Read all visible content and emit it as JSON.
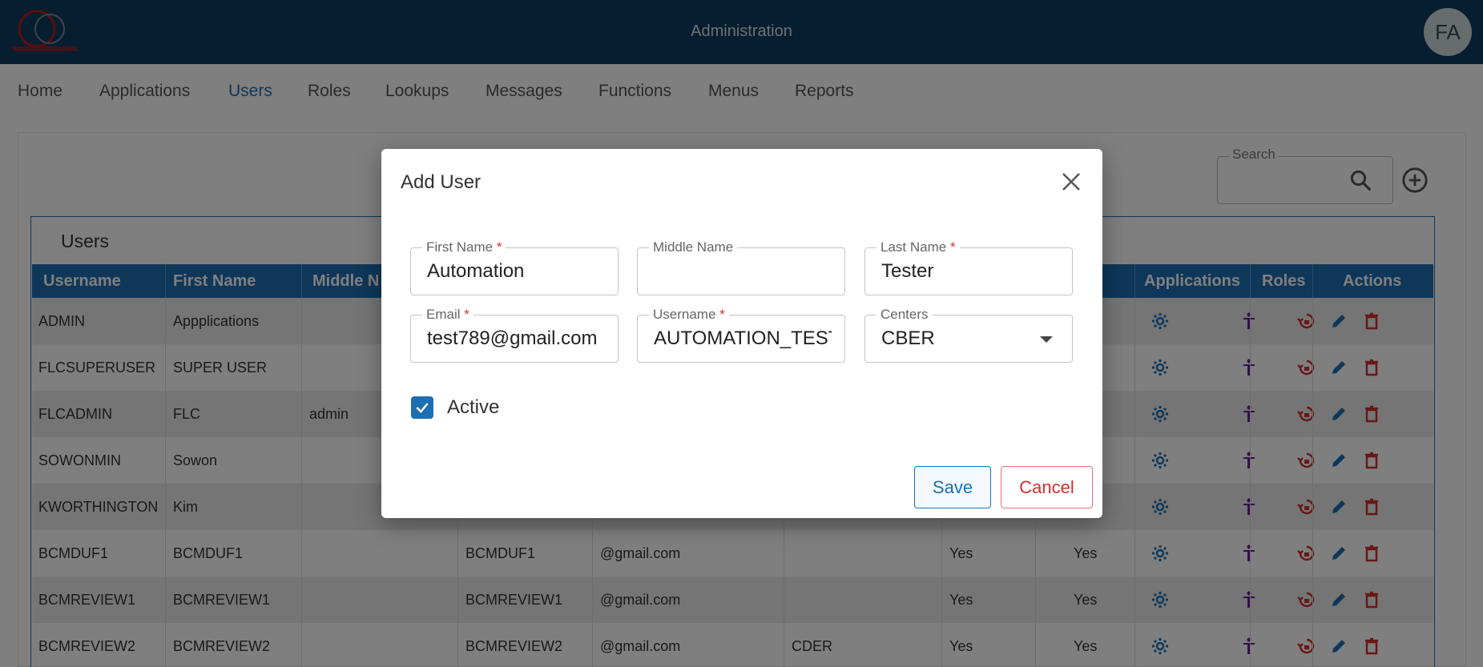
{
  "header": {
    "title": "Administration",
    "avatar_initials": "FA"
  },
  "nav": {
    "items": [
      "Home",
      "Applications",
      "Users",
      "Roles",
      "Lookups",
      "Messages",
      "Functions",
      "Menus",
      "Reports"
    ],
    "active": "Users"
  },
  "toolbar": {
    "search_label": "Search"
  },
  "table": {
    "title": "Users",
    "columns": [
      "Username",
      "First Name",
      "Middle N",
      "Applications",
      "Roles",
      "Actions"
    ],
    "rows": [
      {
        "username": "ADMIN",
        "first_name": "Appplications",
        "middle_name": "",
        "last_name": "",
        "email": "",
        "center": "",
        "flag1": "",
        "flag2": ""
      },
      {
        "username": "FLCSUPERUSER",
        "first_name": "SUPER USER",
        "middle_name": "",
        "last_name": "",
        "email": "",
        "center": "",
        "flag1": "",
        "flag2": ""
      },
      {
        "username": "FLCADMIN",
        "first_name": "FLC",
        "middle_name": "admin",
        "last_name": "",
        "email": "",
        "center": "",
        "flag1": "",
        "flag2": ""
      },
      {
        "username": "SOWONMIN",
        "first_name": "Sowon",
        "middle_name": "",
        "last_name": "",
        "email": "",
        "center": "",
        "flag1": "",
        "flag2": ""
      },
      {
        "username": "KWORTHINGTON",
        "first_name": "Kim",
        "middle_name": "",
        "last_name": "",
        "email": "",
        "center": "",
        "flag1": "",
        "flag2": ""
      },
      {
        "username": "BCMDUF1",
        "first_name": "BCMDUF1",
        "middle_name": "",
        "last_name": "BCMDUF1",
        "email": "@gmail.com",
        "center": "",
        "flag1": "Yes",
        "flag2": "Yes"
      },
      {
        "username": "BCMREVIEW1",
        "first_name": "BCMREVIEW1",
        "middle_name": "",
        "last_name": "BCMREVIEW1",
        "email": "@gmail.com",
        "center": "",
        "flag1": "Yes",
        "flag2": "Yes"
      },
      {
        "username": "BCMREVIEW2",
        "first_name": "BCMREVIEW2",
        "middle_name": "",
        "last_name": "BCMREVIEW2",
        "email": "@gmail.com",
        "center": "CDER",
        "flag1": "Yes",
        "flag2": "Yes"
      }
    ]
  },
  "dialog": {
    "title": "Add User",
    "fields": {
      "first_name": {
        "label": "First Name",
        "required": "*",
        "value": "Automation"
      },
      "middle_name": {
        "label": "Middle Name",
        "value": ""
      },
      "last_name": {
        "label": "Last Name",
        "required": "*",
        "value": "Tester"
      },
      "email": {
        "label": "Email",
        "required": "*",
        "value": "test789@gmail.com"
      },
      "username": {
        "label": "Username",
        "required": "*",
        "value": "AUTOMATION_TEST"
      },
      "centers": {
        "label": "Centers",
        "value": "CBER"
      }
    },
    "active": {
      "label": "Active",
      "checked": true
    },
    "save_label": "Save",
    "cancel_label": "Cancel"
  },
  "colors": {
    "header_bg": "#0c3c5e",
    "primary": "#1c6fb3",
    "role_icon": "#6a1b9a",
    "danger": "#d32f2f"
  },
  "icons": {
    "row_actions": [
      "gear-icon",
      "person-icon",
      "reset-password-icon",
      "pencil-icon",
      "trash-icon"
    ]
  }
}
